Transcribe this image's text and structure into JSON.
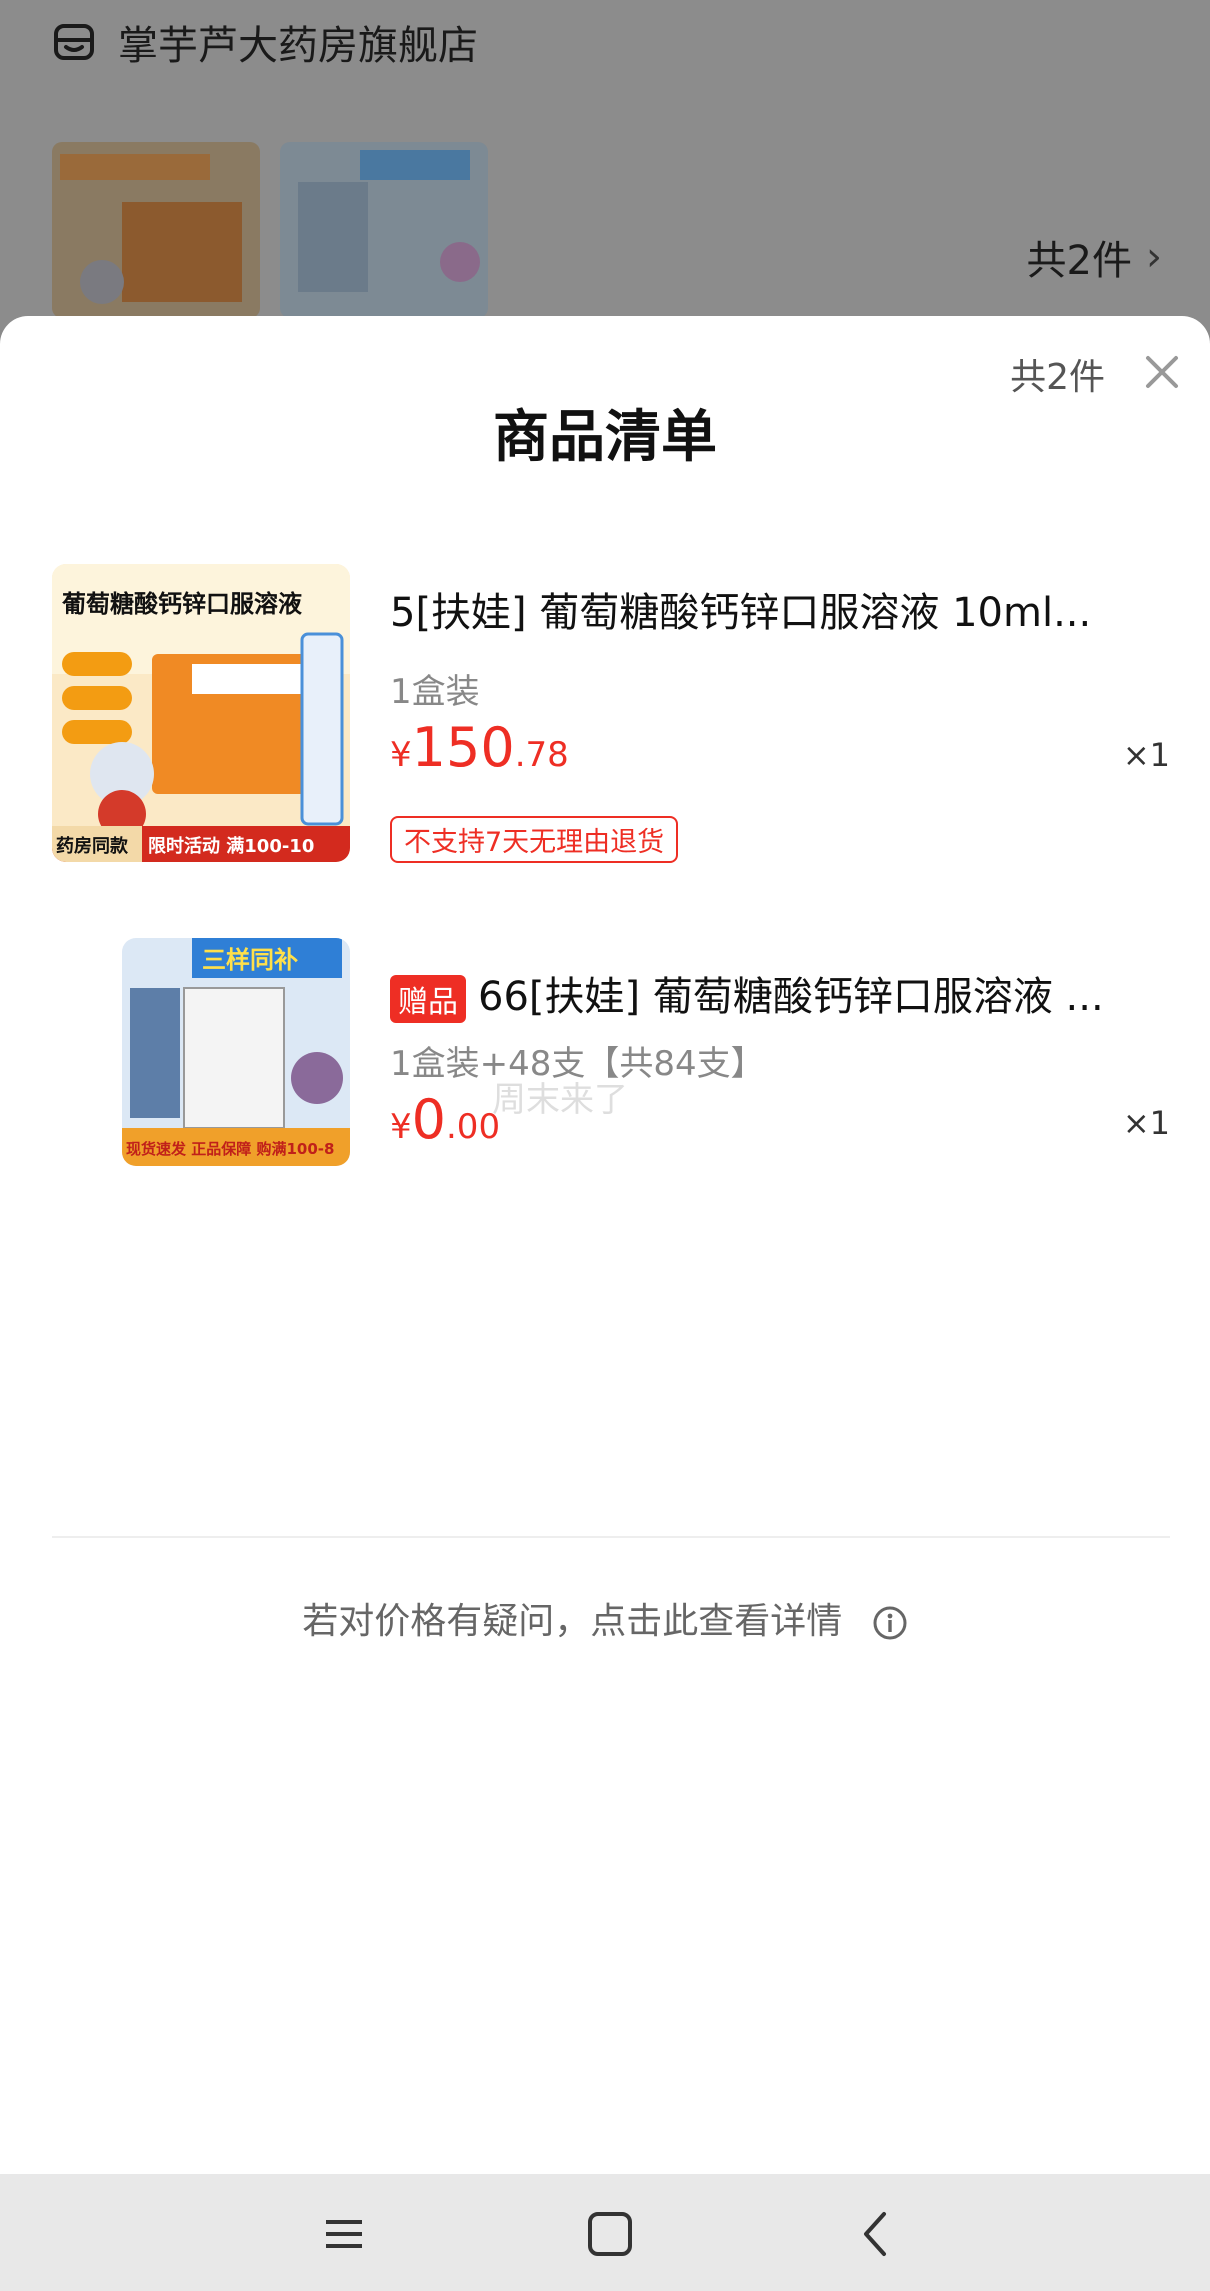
{
  "background": {
    "store_name": "掌芋芦大药房旗舰店",
    "item_count": "共2件",
    "chevron": "›"
  },
  "sheet": {
    "title": "商品清单",
    "count": "共2件",
    "close_icon": "close-icon"
  },
  "items": [
    {
      "title": "5[扶娃] 葡萄糖酸钙锌口服溶液 10ml...",
      "spec": "1盒装",
      "price_currency": "¥",
      "price_int": "150",
      "price_dec": ".78",
      "qty": "×1",
      "tag": "不支持7天无理由退货",
      "image_text": "葡萄糖酸钙锌口服溶液",
      "image_promo": "限时活动 满100-10",
      "image_label": "药房同款"
    },
    {
      "badge": "赠品",
      "title": "66[扶娃] 葡萄糖酸钙锌口服溶液 ...",
      "spec": "1盒装+48支【共84支】",
      "price_currency": "¥",
      "price_int": "0",
      "price_dec": ".00",
      "qty": "×1",
      "image_text": "三样同补",
      "image_promo": "现货速发  正品保障  购满100-8"
    }
  ],
  "watermark": "周末来了",
  "help_text": "若对价格有疑问，点击此查看详情",
  "colors": {
    "accent_red": "#ee2e24",
    "overlay": "#8c8c8c"
  },
  "navbar": {
    "menu_icon": "menu-icon",
    "home_icon": "home-icon",
    "back_icon": "back-icon"
  }
}
